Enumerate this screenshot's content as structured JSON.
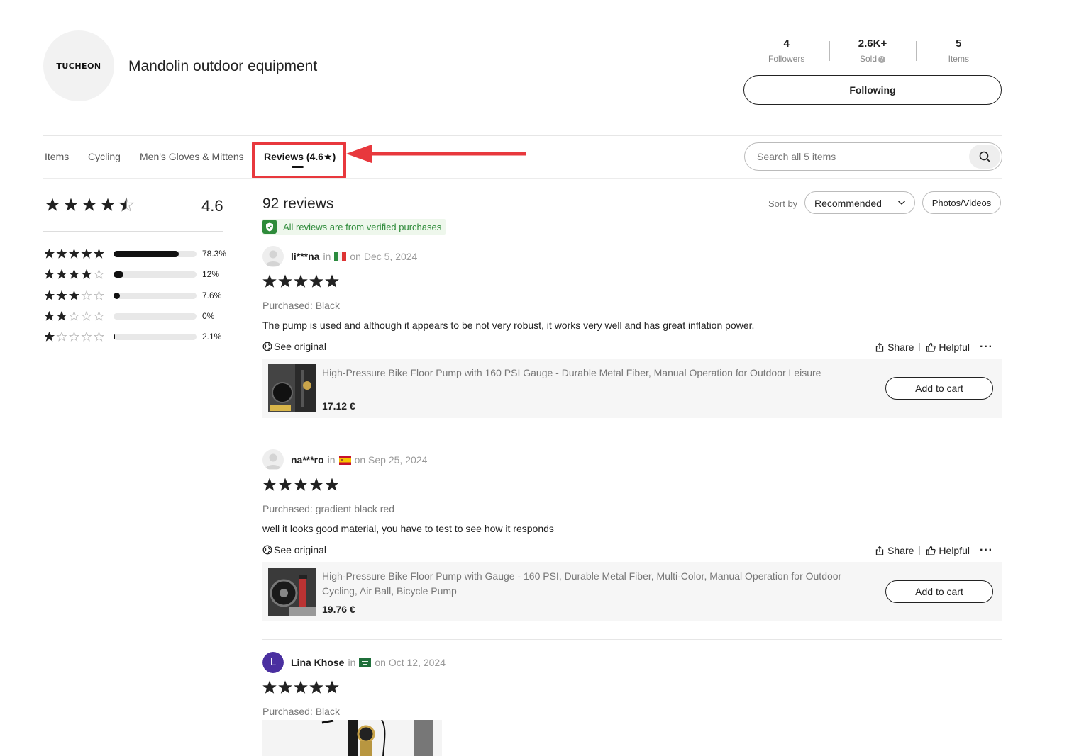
{
  "store": {
    "logo_text": "TUCHEON",
    "name": "Mandolin outdoor equipment",
    "stats": [
      {
        "value": "4",
        "label": "Followers"
      },
      {
        "value": "2.6K+",
        "label": "Sold"
      },
      {
        "value": "5",
        "label": "Items"
      }
    ],
    "follow_label": "Following"
  },
  "tabs": [
    {
      "label": "Items"
    },
    {
      "label": "Cycling"
    },
    {
      "label": "Men's Gloves & Mittens"
    },
    {
      "label": "Reviews (4.6★)",
      "active": true
    }
  ],
  "search": {
    "placeholder": "Search all 5 items"
  },
  "summary": {
    "score": "4.6",
    "stars": 4.6,
    "distribution": [
      {
        "stars": 5,
        "percent_label": "78.3%",
        "fraction": 0.783
      },
      {
        "stars": 4,
        "percent_label": "12%",
        "fraction": 0.12
      },
      {
        "stars": 3,
        "percent_label": "7.6%",
        "fraction": 0.076
      },
      {
        "stars": 2,
        "percent_label": "0%",
        "fraction": 0.0
      },
      {
        "stars": 1,
        "percent_label": "2.1%",
        "fraction": 0.021
      }
    ]
  },
  "reviews_header": {
    "count_label": "92 reviews",
    "verified_text": "All reviews are from verified purchases",
    "sort_label": "Sort by",
    "sort_value": "Recommended",
    "photos_label": "Photos/Videos"
  },
  "reviews": [
    {
      "name": "li***na",
      "in": "in",
      "country_flag": "italy-flag",
      "date": "on Dec 5, 2024",
      "rating": 5,
      "purchased": "Purchased: Black",
      "text": "The pump is used and although it appears to be not very robust, it works very well and has great inflation power.",
      "see_original": "See original",
      "share": "Share",
      "helpful": "Helpful",
      "product": {
        "title": "High-Pressure Bike Floor Pump with 160 PSI Gauge - Durable Metal Fiber, Manual Operation for Outdoor Leisure",
        "price": "17.12 €",
        "cart_label": "Add to cart"
      }
    },
    {
      "name": "na***ro",
      "in": "in",
      "country_flag": "spain-flag",
      "date": "on Sep 25, 2024",
      "rating": 5,
      "purchased": "Purchased: gradient black red",
      "text": "well it looks good material, you have to test to see how it responds",
      "see_original": "See original",
      "share": "Share",
      "helpful": "Helpful",
      "product": {
        "title": "High-Pressure Bike Floor Pump with Gauge - 160 PSI, Durable Metal Fiber, Multi-Color, Manual Operation for Outdoor Cycling, Air Ball, Bicycle Pump",
        "price": "19.76 €",
        "cart_label": "Add to cart"
      }
    },
    {
      "name": "Lina Khose",
      "avatar_letter": "L",
      "in": "in",
      "country_flag": "saudi-arabia-flag",
      "date": "on Oct 12, 2024",
      "rating": 5,
      "purchased": "Purchased: Black"
    }
  ],
  "colors": {
    "highlight": "#e8383d",
    "verified_green": "#2e8b3a",
    "avatar_purple": "#4a2fa0"
  }
}
